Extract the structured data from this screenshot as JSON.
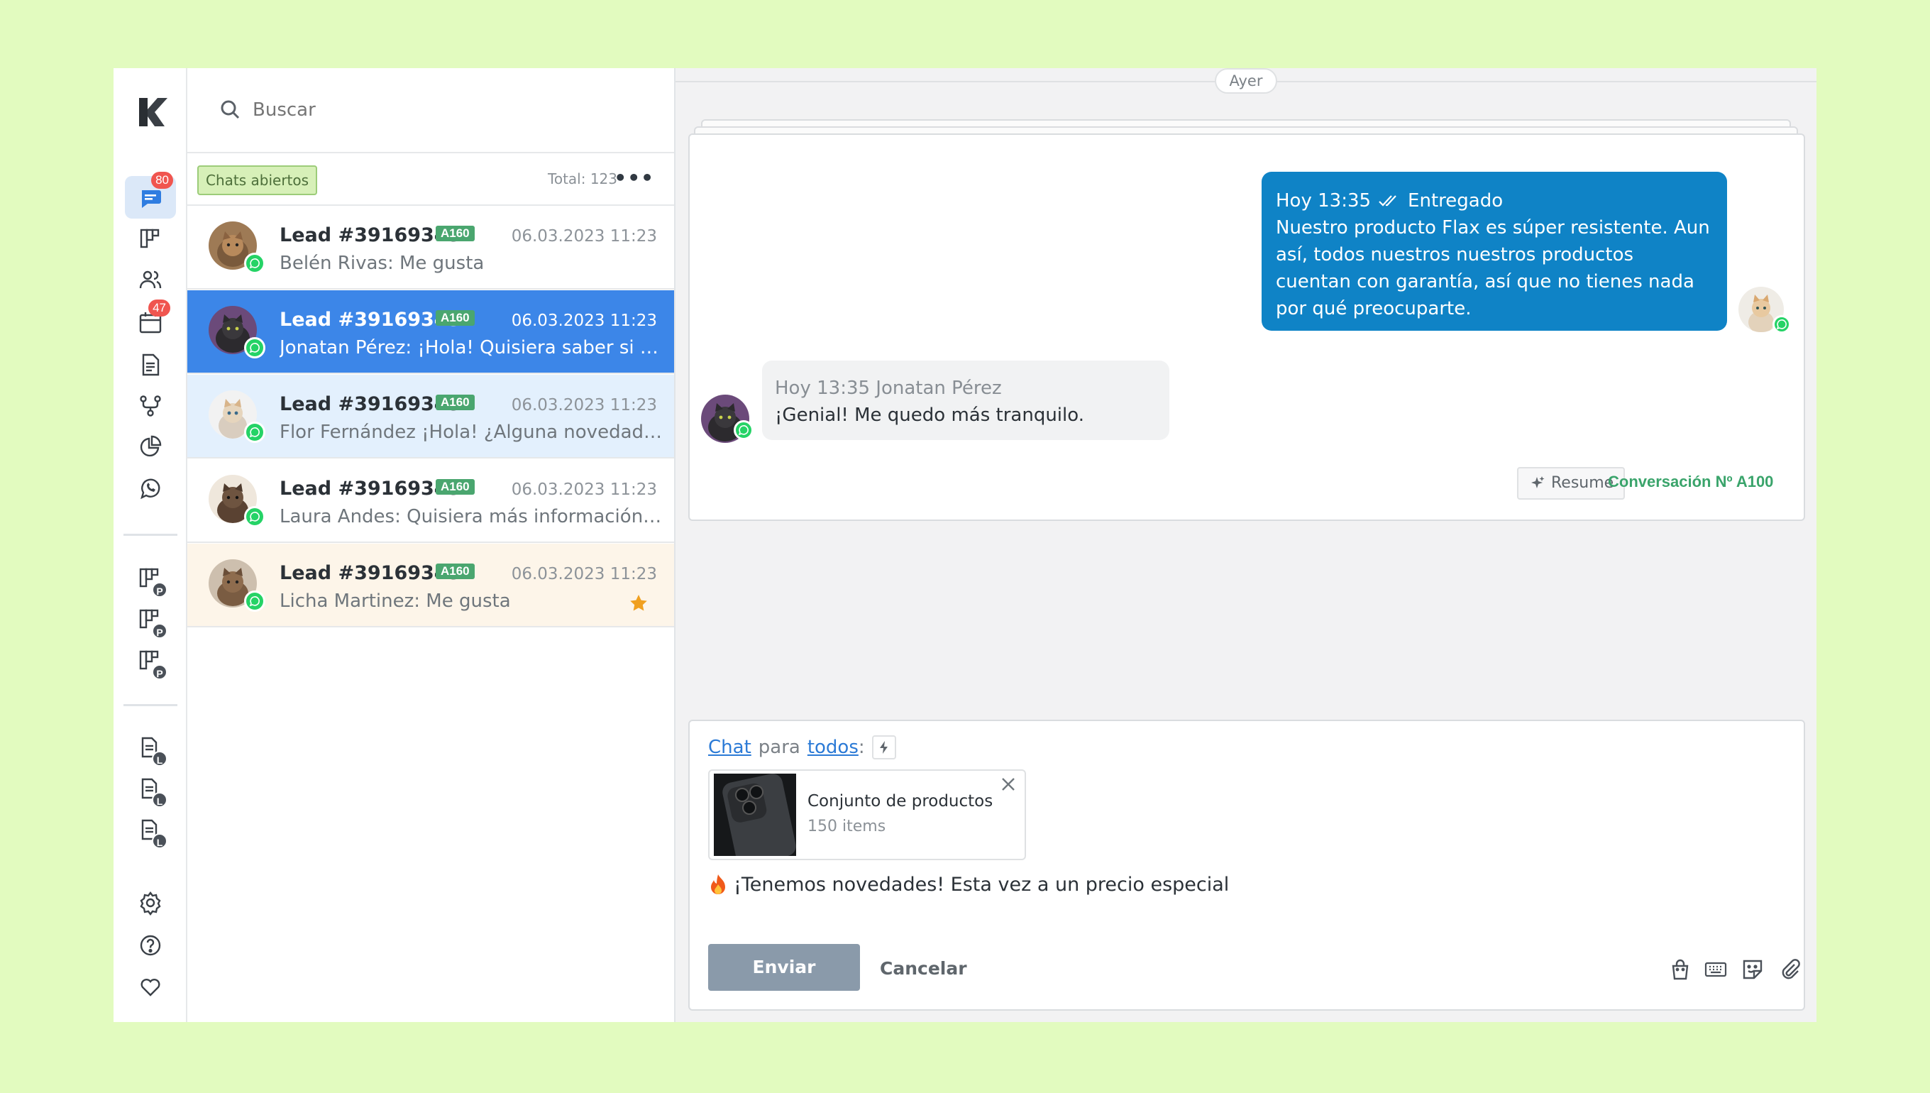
{
  "search": {
    "placeholder": "Buscar"
  },
  "rail": {
    "chats_badge": "80",
    "calendar_badge": "47",
    "pipeline_badge": "P",
    "list_badge": "L"
  },
  "list_header": {
    "filter": "Chats abiertos",
    "total": "Total: 123",
    "more": "•••"
  },
  "chats": [
    {
      "title": "Lead #39169345",
      "tag": "A160",
      "time": "06.03.2023 11:23",
      "preview": "Belén Rivas: Me gusta",
      "state": "normal"
    },
    {
      "title": "Lead #39169345",
      "tag": "A160",
      "time": "06.03.2023 11:23",
      "preview": "Jonatan Pérez: ¡Hola! Quisiera saber si el producto está disponible",
      "state": "selected"
    },
    {
      "title": "Lead #39169345",
      "tag": "A160",
      "time": "06.03.2023 11:23",
      "preview": "Flor Fernández ¡Hola! ¿Alguna novedad sobre mi pedido?",
      "state": "hover"
    },
    {
      "title": "Lead #39169345",
      "tag": "A160",
      "time": "06.03.2023 11:23",
      "preview": "Laura Andes: Quisiera más información sobre el producto",
      "state": "normal"
    },
    {
      "title": "Lead #39169345",
      "tag": "A160",
      "time": "06.03.2023 11:23",
      "preview": "Licha Martinez: Me gusta",
      "state": "favorite"
    }
  ],
  "conversation": {
    "day": "Ayer",
    "outgoing": {
      "time": "Hoy 13:35",
      "status": "Entregado",
      "text": "Nuestro producto Flax es súper resistente. Aun así, todos nuestros nuestros productos cuentan con garantía, así que no tienes nada por qué preocuparte."
    },
    "incoming": {
      "meta": "Hoy 13:35 Jonatan Pérez",
      "text": "¡Genial! Me quedo más tranquilo."
    },
    "resume_label": "Resume",
    "conversation_no": "Conversación Nº A100"
  },
  "composer": {
    "mode": "Chat",
    "for": "para",
    "target": "todos",
    "colon": ":",
    "attachment": {
      "title": "Conjunto de productos",
      "subtitle": "150 items"
    },
    "message": "¡Tenemos novedades! Esta vez a un precio especial",
    "send": "Enviar",
    "cancel": "Cancelar"
  },
  "colors": {
    "accent": "#3c86e8",
    "outgoing_bubble": "#0f83c6",
    "whatsapp": "#25d366",
    "tag": "#4aa66f",
    "background": "#e2fbbf"
  }
}
